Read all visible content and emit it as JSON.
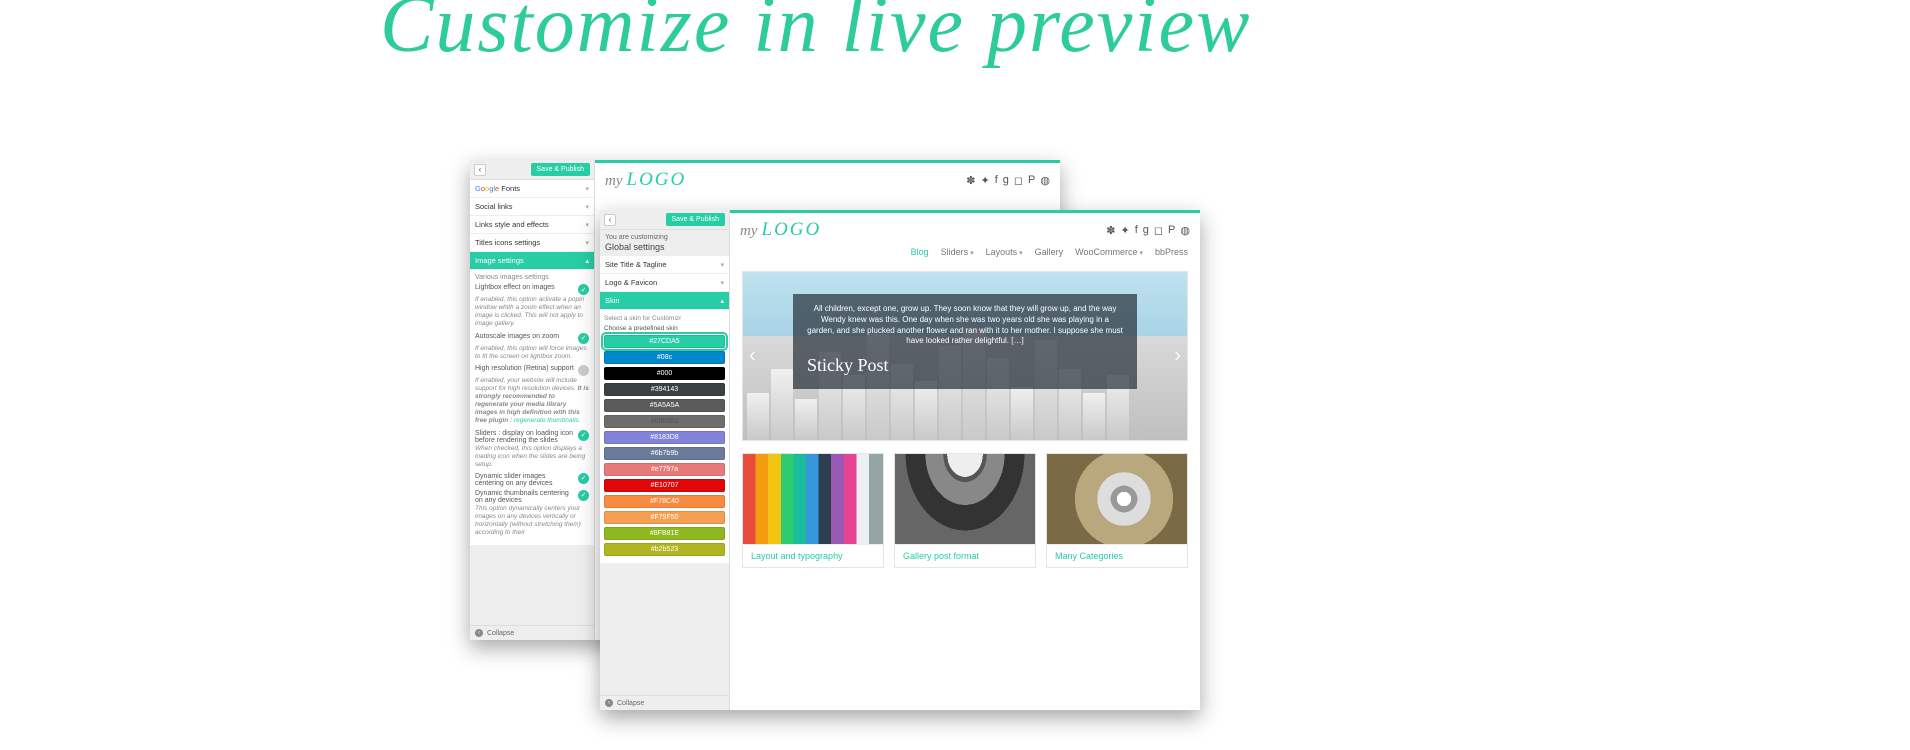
{
  "hero_title": "Customize in live preview",
  "back_window": {
    "save_label": "Save & Publish",
    "collapse_label": "Collapse",
    "sections": {
      "google_fonts": "Fonts",
      "social_links": "Social links",
      "links_style": "Links style and effects",
      "titles_icons": "Titles icons settings",
      "image_settings": "Image settings"
    },
    "panel": {
      "heading": "Various images settings",
      "opt1": {
        "label": "Lightbox effect on images",
        "desc": "If enabled, this option activate a popin window whith a zoom effect when an image is clicked. This will not apply to image gallery."
      },
      "opt2": {
        "label": "Autoscale images on zoom",
        "desc": "If enabled, this option will force images to fit the screen on lightbox zoom."
      },
      "opt3": {
        "label": "High resolution (Retina) support",
        "desc_a": "If enabled, your website will include support for high resolution devices.",
        "desc_b": " It is strongly recommended to regenerate your media library images in high definition with this free plugin : ",
        "desc_link": "regenerate thumbnails."
      },
      "opt4": {
        "label": "Sliders : display on loading icon before rendering the slides",
        "desc": "When checked, this option displays a loading icon when the slides are being setup."
      },
      "opt5": {
        "label": "Dynamic slider images centering on any devices"
      },
      "opt6": {
        "label": "Dynamic thumbnails centering on any devices",
        "desc": "This option dynamically centers your images on any devices vertically or horizontally (without stretching them) according to their"
      }
    },
    "logo": {
      "my": "my",
      "text": "LOGO"
    }
  },
  "front_window": {
    "save_label": "Save & Publish",
    "collapse_label": "Collapse",
    "intro_small": "You are customizing",
    "intro_big": "Global settings",
    "sections": {
      "site_title": "Site Title & Tagline",
      "logo_favicon": "Logo & Favicon",
      "skin": "Skin"
    },
    "skin_hint1": "Select a skin for Customizr",
    "skin_hint2": "Choose a predefined skin",
    "skins": [
      {
        "hex": "#27CDA5",
        "label": "#27CDA5"
      },
      {
        "hex": "#0088cc",
        "label": "#08c"
      },
      {
        "hex": "#000000",
        "label": "#000"
      },
      {
        "hex": "#394143",
        "label": "#394143"
      },
      {
        "hex": "#5A5A5A",
        "label": "#5A5A5A"
      },
      {
        "hex": "#6d6d6d",
        "label": "#6d6d6d",
        "light": true
      },
      {
        "hex": "#8183D8",
        "label": "#8183D8"
      },
      {
        "hex": "#6b7b9b",
        "label": "#6b7b9b"
      },
      {
        "hex": "#e7797a",
        "label": "#e7797a"
      },
      {
        "hex": "#E10707",
        "label": "#E10707"
      },
      {
        "hex": "#F78C40",
        "label": "#F78C40"
      },
      {
        "hex": "#F79F50",
        "label": "#F79F50"
      },
      {
        "hex": "#8FB81E",
        "label": "#8FB81E"
      },
      {
        "hex": "#b2b523",
        "label": "#b2b523"
      }
    ],
    "logo": {
      "my": "my",
      "text": "LOGO"
    },
    "nav": {
      "blog": "Blog",
      "sliders": "Sliders",
      "layouts": "Layouts",
      "gallery": "Gallery",
      "woo": "WooCommerce",
      "bbpress": "bbPress"
    },
    "hero_text": "All children, except one, grow up. They soon know that they will grow up, and the way Wendy knew was this. One day when she was two years old she was playing in a garden, and she plucked another flower and ran with it to her mother. I suppose she must have looked rather delightful. […]",
    "hero_sticky": "Sticky Post",
    "cards": {
      "c1": "Layout and typography",
      "c2": "Gallery post format",
      "c3": "Many Categories"
    }
  }
}
